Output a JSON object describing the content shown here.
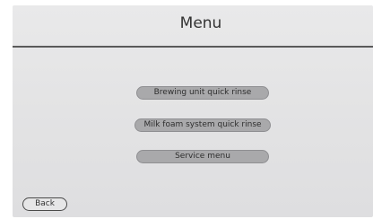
{
  "header": {
    "title": "Menu"
  },
  "menu": {
    "items": [
      {
        "label": "Brewing unit quick rinse"
      },
      {
        "label": "Milk foam system quick rinse"
      },
      {
        "label": "Service menu"
      }
    ]
  },
  "footer": {
    "back_label": "Back"
  },
  "colors": {
    "background": "#e4e4e5",
    "button_fill": "#a9a9ab",
    "divider": "#5a5a5a"
  }
}
